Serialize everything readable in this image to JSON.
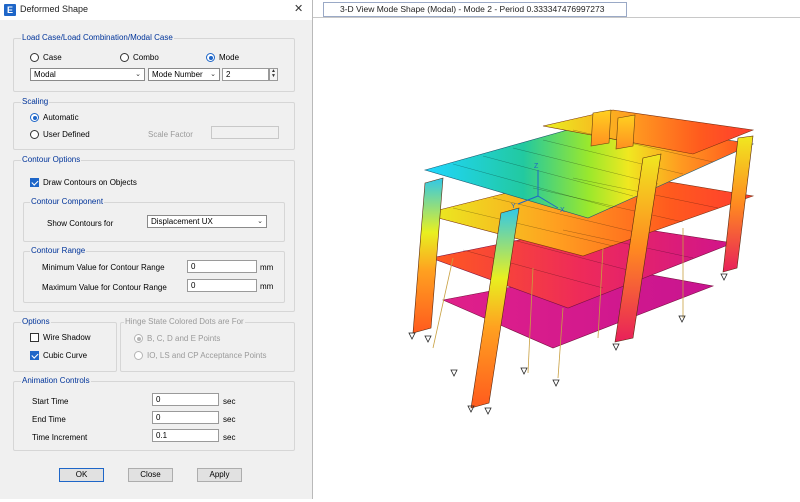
{
  "dialog": {
    "title": "Deformed Shape",
    "app_icon": "E",
    "close_glyph": "✕",
    "load_group": {
      "label": "Load Case/Load Combination/Modal Case",
      "radio_case": "Case",
      "radio_combo": "Combo",
      "radio_mode": "Mode",
      "selected": "Mode",
      "case_select": "Modal",
      "mode_select": "Mode Number",
      "mode_number": "2"
    },
    "scaling": {
      "label": "Scaling",
      "automatic": "Automatic",
      "user_defined": "User Defined",
      "selected": "Automatic",
      "scale_factor_label": "Scale Factor",
      "scale_factor_value": ""
    },
    "contour": {
      "label": "Contour Options",
      "draw_contours": "Draw Contours on Objects",
      "draw_contours_checked": true,
      "component_label": "Contour Component",
      "show_contours_label": "Show Contours for",
      "show_contours_value": "Displacement UX",
      "range_label": "Contour Range",
      "min_label": "Minimum Value for Contour Range",
      "min_value": "0",
      "min_unit": "mm",
      "max_label": "Maximum Value for Contour Range",
      "max_value": "0",
      "max_unit": "mm"
    },
    "options": {
      "label": "Options",
      "wire_shadow": "Wire Shadow",
      "wire_shadow_checked": false,
      "cubic_curve": "Cubic Curve",
      "cubic_curve_checked": true
    },
    "hinge": {
      "label": "Hinge State Colored Dots are For",
      "opt1": "B, C, D and E Points",
      "opt2": "IO, LS and CP Acceptance Points"
    },
    "animation": {
      "label": "Animation Controls",
      "start_label": "Start Time",
      "start_value": "0",
      "end_label": "End Time",
      "end_value": "0",
      "inc_label": "Time Increment",
      "inc_value": "0.1",
      "unit": "sec"
    },
    "buttons": {
      "ok": "OK",
      "close": "Close",
      "apply": "Apply"
    }
  },
  "view": {
    "tab_title": "3-D View  Mode Shape (Modal) - Mode 2 - Period 0.333347476997273",
    "axis_labels": {
      "z": "Z",
      "x": "X",
      "y": "Y"
    },
    "contour_colors": [
      "#1fd6ff",
      "#22c9a0",
      "#7ce830",
      "#e8f020",
      "#ffb020",
      "#ff5a1e",
      "#e8205a",
      "#d0148c"
    ],
    "accent": "#1e66c8"
  }
}
